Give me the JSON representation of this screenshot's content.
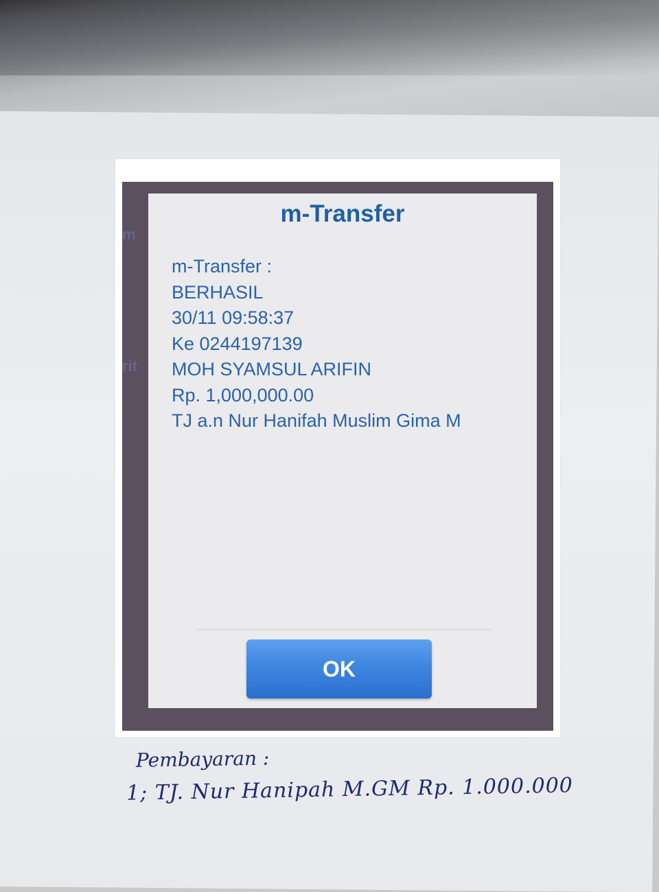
{
  "dialog": {
    "title": "m-Transfer",
    "lines": [
      "m-Transfer :",
      "BERHASIL",
      "30/11 09:58:37",
      "Ke 0244197139",
      "MOH SYAMSUL ARIFIN",
      "Rp. 1,000,000.00",
      "TJ a.n Nur Hanifah Muslim Gima M"
    ],
    "ok_label": "OK"
  },
  "handwritten_note": {
    "line1": "Pembayaran :",
    "line2": "1; TJ. Nur Hanipah M.GM  Rp. 1.000.000"
  },
  "colors": {
    "title_text": "#1f5fa8",
    "message_text": "#2a62ad",
    "ok_button": "#3f86e0",
    "frame": "#5a5060",
    "ink": "#1d2a6e"
  }
}
